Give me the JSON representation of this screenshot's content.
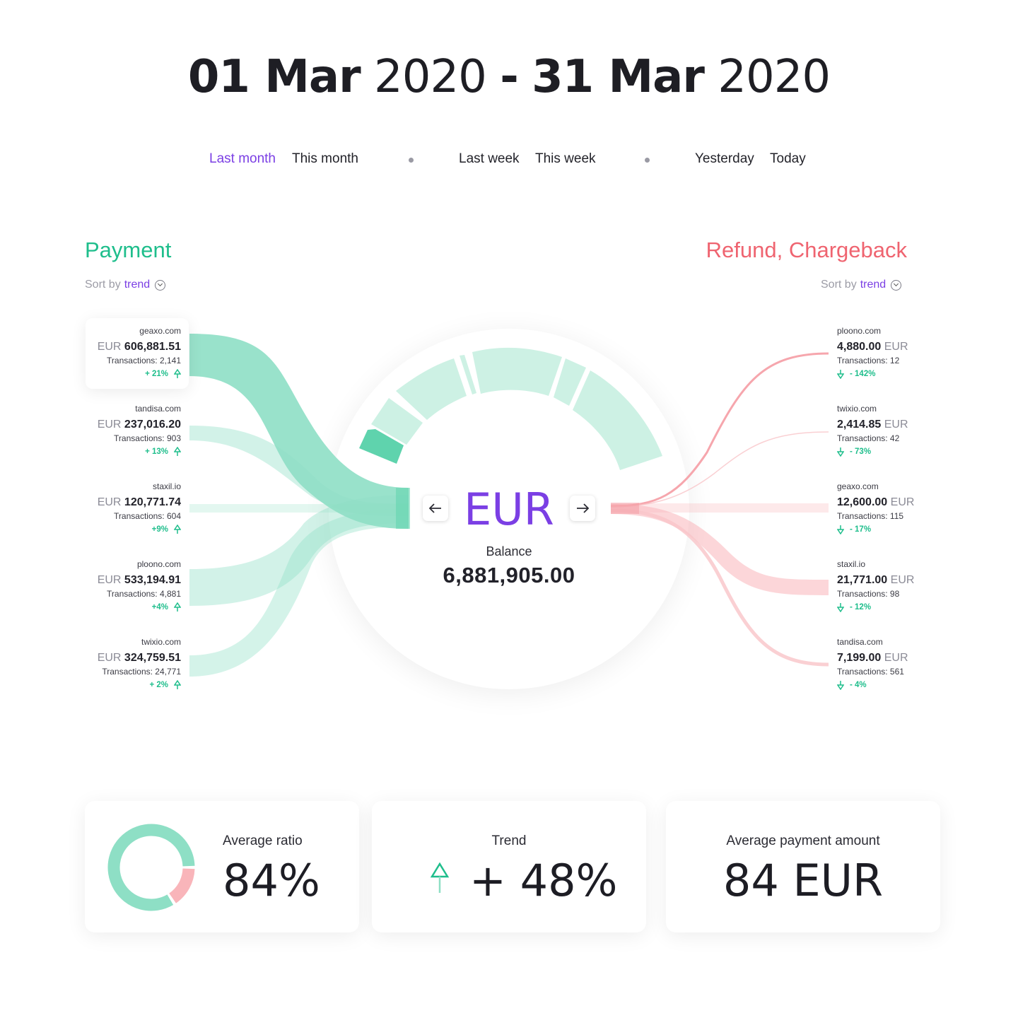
{
  "header": {
    "start_day": "01 Mar",
    "start_year": "2020",
    "separator": "-",
    "end_day": "31 Mar",
    "end_year": "2020"
  },
  "periods": {
    "last_month": "Last month",
    "this_month": "This month",
    "last_week": "Last week",
    "this_week": "This week",
    "yesterday": "Yesterday",
    "today": "Today",
    "active": "last_month"
  },
  "payment": {
    "title": "Payment",
    "sort_label": "Sort by",
    "sort_value": "trend",
    "items": [
      {
        "domain": "geaxo.com",
        "currency": "EUR",
        "amount": "606,881.51",
        "transactions": "Transactions: 2,141",
        "trend": "+ 21%"
      },
      {
        "domain": "tandisa.com",
        "currency": "EUR",
        "amount": "237,016.20",
        "transactions": "Transactions: 903",
        "trend": "+ 13%"
      },
      {
        "domain": "staxil.io",
        "currency": "EUR",
        "amount": "120,771.74",
        "transactions": "Transactions: 604",
        "trend": "+9%"
      },
      {
        "domain": "ploono.com",
        "currency": "EUR",
        "amount": "533,194.91",
        "transactions": "Transactions: 4,881",
        "trend": "+4%"
      },
      {
        "domain": "twixio.com",
        "currency": "EUR",
        "amount": "324,759.51",
        "transactions": "Transactions: 24,771",
        "trend": "+ 2%"
      }
    ]
  },
  "refund": {
    "title": "Refund, Chargeback",
    "sort_label": "Sort by",
    "sort_value": "trend",
    "items": [
      {
        "domain": "ploono.com",
        "currency": "EUR",
        "amount": "4,880.00",
        "transactions": "Transactions: 12",
        "trend": "- 142%"
      },
      {
        "domain": "twixio.com",
        "currency": "EUR",
        "amount": "2,414.85",
        "transactions": "Transactions: 42",
        "trend": "- 73%"
      },
      {
        "domain": "geaxo.com",
        "currency": "EUR",
        "amount": "12,600.00",
        "transactions": "Transactions: 115",
        "trend": "- 17%"
      },
      {
        "domain": "staxil.io",
        "currency": "EUR",
        "amount": "21,771.00",
        "transactions": "Transactions: 98",
        "trend": "- 12%"
      },
      {
        "domain": "tandisa.com",
        "currency": "EUR",
        "amount": "7,199.00",
        "transactions": "Transactions: 561",
        "trend": "- 4%"
      }
    ]
  },
  "center": {
    "currency": "EUR",
    "balance_label": "Balance",
    "balance_value": "6,881,905.00"
  },
  "stats": {
    "ratio_label": "Average ratio",
    "ratio_value": "84%",
    "ratio_fraction": 0.84,
    "trend_label": "Trend",
    "trend_value": "+ 48%",
    "avg_label": "Average payment amount",
    "avg_value": "84 EUR"
  },
  "colors": {
    "accent": "#7b3fe4",
    "payment": "#1fbe8c",
    "refund": "#ef6470",
    "flow_payment": "#8edfc5",
    "flow_refund": "#f9b5ba"
  }
}
